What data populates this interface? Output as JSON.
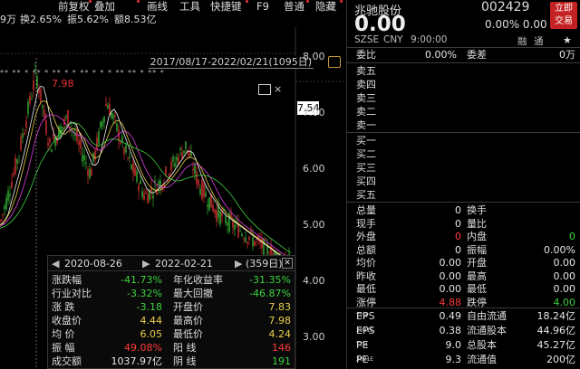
{
  "toolbar": {
    "items": [
      "前复权",
      "叠加",
      "画线",
      "工具",
      "快捷键",
      "F9",
      "普通",
      "隐藏"
    ],
    "dots": [
      "前复权",
      "叠加",
      "快捷键",
      "普通",
      "隐藏"
    ]
  },
  "stats_line": {
    "vol": "9万",
    "turnover": "换2.65%",
    "amplitude": "振5.62%",
    "amount": "额8.53亿"
  },
  "chart": {
    "date_range": "2017/08/17-2022/02/21(1095日)",
    "stars": "** ** * ** * ** * * ** * * * ** ** * ** *",
    "peak_label": "7.98",
    "current_price": "7.54",
    "y_ticks": [
      "8.00",
      "7.00",
      "6.00",
      "5.00",
      "4.00",
      "3.00"
    ],
    "maximize_icon": "maximize-icon",
    "close_icon": "close-icon",
    "close_glyph": "×",
    "colors": {
      "up": "#ff3b3b",
      "down": "#3fd13f",
      "ma1": "#f0f0f0",
      "ma2": "#e8d04a",
      "ma3": "#e040e0",
      "ma4": "#3fd13f"
    }
  },
  "range_panel": {
    "start_date": "2020-08-26",
    "end_date": "2022-02-21",
    "days": "(359日)",
    "rows": [
      {
        "l1": "涨跌幅",
        "v1": "-41.73%",
        "c1": "green",
        "l2": "年化收益率",
        "v2": "-31.35%",
        "c2": "green"
      },
      {
        "l1": "行业对比",
        "v1": "-3.32%",
        "c1": "green",
        "l2": "最大回撤",
        "v2": "-46.87%",
        "c2": "green"
      },
      {
        "l1": "涨   跌",
        "v1": "-3.18",
        "c1": "green",
        "l2": "开盘价",
        "v2": "7.83",
        "c2": "yel"
      },
      {
        "l1": "收盘价",
        "v1": "4.44",
        "c1": "yel",
        "l2": "最高价",
        "v2": "7.98",
        "c2": "yel"
      },
      {
        "l1": "均   价",
        "v1": "6.05",
        "c1": "yel",
        "l2": "最低价",
        "v2": "4.24",
        "c2": "yel"
      },
      {
        "l1": "振   幅",
        "v1": "49.08%",
        "c1": "red",
        "l2": "阳   线",
        "v2": "146",
        "c2": "red"
      },
      {
        "l1": "成交额",
        "v1": "1037.97亿",
        "c1": "wht",
        "l2": "阴   线",
        "v2": "191",
        "c2": "green"
      }
    ]
  },
  "quote": {
    "name": "兆驰股份",
    "code": "002429",
    "trade_button": [
      "立即",
      "交易"
    ],
    "price": "0.00",
    "change": "0.00% 0.00",
    "exchange": "SZSE",
    "currency": "CNY",
    "time": "9:00:00",
    "tag_margin": "融",
    "tag_connect": "通",
    "star": "★",
    "weibi": {
      "label": "委比",
      "value": "0.00%",
      "label2": "委差",
      "value2": "0万"
    },
    "sell": [
      "卖五",
      "卖四",
      "卖三",
      "卖二",
      "卖一"
    ],
    "buy": [
      "买一",
      "买二",
      "买三",
      "买四",
      "买五"
    ],
    "detail": [
      {
        "l1": "总量",
        "v1": "0",
        "c1": "wht",
        "l2": "换手",
        "v2": "",
        "c2": "wht"
      },
      {
        "l1": "现手",
        "v1": "0",
        "c1": "wht",
        "l2": "量比",
        "v2": "",
        "c2": "wht"
      },
      {
        "l1": "外盘",
        "v1": "0",
        "c1": "red",
        "l2": "内盘",
        "v2": "0",
        "c2": "green"
      },
      {
        "l1": "总额",
        "v1": "0",
        "c1": "wht",
        "l2": "振幅",
        "v2": "0.00%",
        "c2": "wht"
      },
      {
        "l1": "均价",
        "v1": "0.00",
        "c1": "wht",
        "l2": "开盘",
        "v2": "0.00",
        "c2": "wht"
      },
      {
        "l1": "昨收",
        "v1": "0.00",
        "c1": "wht",
        "l2": "最高",
        "v2": "0.00",
        "c2": "wht"
      },
      {
        "l1": "最低",
        "v1": "0.00",
        "c1": "wht",
        "l2": "最低",
        "v2": "0.00",
        "c2": "wht"
      },
      {
        "l1": "涨停",
        "v1": "4.88",
        "c1": "red",
        "l2": "跌停",
        "v2": "4.00",
        "c2": "green"
      }
    ],
    "fund": [
      {
        "l1": "EPS",
        "s1": "TTM",
        "v1": "0.49",
        "l2": "自由流通",
        "v2": "18.24亿"
      },
      {
        "l1": "EPS",
        "s1": "2021E",
        "v1": "0.38",
        "l2": "流通股本",
        "v2": "44.96亿"
      },
      {
        "l1": "PE",
        "s1": "TTM",
        "v1": "9.0",
        "l2": "总股本",
        "v2": "45.27亿"
      },
      {
        "l1": "PE",
        "s1": "2021E",
        "v1": "9.3",
        "l2": "流通值",
        "v2": "200亿"
      }
    ]
  }
}
